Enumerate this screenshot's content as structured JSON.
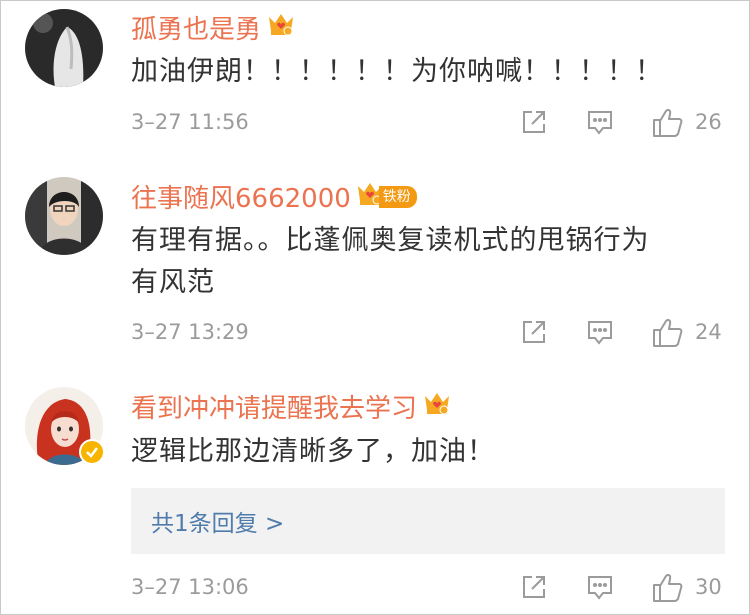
{
  "comments": [
    {
      "username": "孤勇也是勇",
      "lines": [
        "加油伊朗！！！！！！为你呐喊！！！！！"
      ],
      "timestamp": "3–27 11:56",
      "likes": "26",
      "badge_icon": "vip-crown-icon"
    },
    {
      "username": "往事随风6662000",
      "fan_badge": "铁粉",
      "lines": [
        "有理有据。。比蓬佩奥复读机式的甩锅行为",
        "有风范"
      ],
      "timestamp": "3–27 13:29",
      "likes": "24",
      "badge_icon": "vip-crown-icon"
    },
    {
      "username": "看到冲冲请提醒我去学习",
      "lines": [
        "逻辑比那边清晰多了，加油！"
      ],
      "reply_summary": "共1条回复 >",
      "timestamp": "3–27 13:06",
      "likes": "30",
      "badge_icon": "vip-crown-icon",
      "verified_icon": "verified-badge-icon"
    }
  ],
  "colors": {
    "username": "#eb7350",
    "text": "#333333",
    "meta": "#9b9b9b",
    "link": "#4f7cab",
    "reply_bg": "#f2f2f2",
    "crown": "#f7a823"
  }
}
